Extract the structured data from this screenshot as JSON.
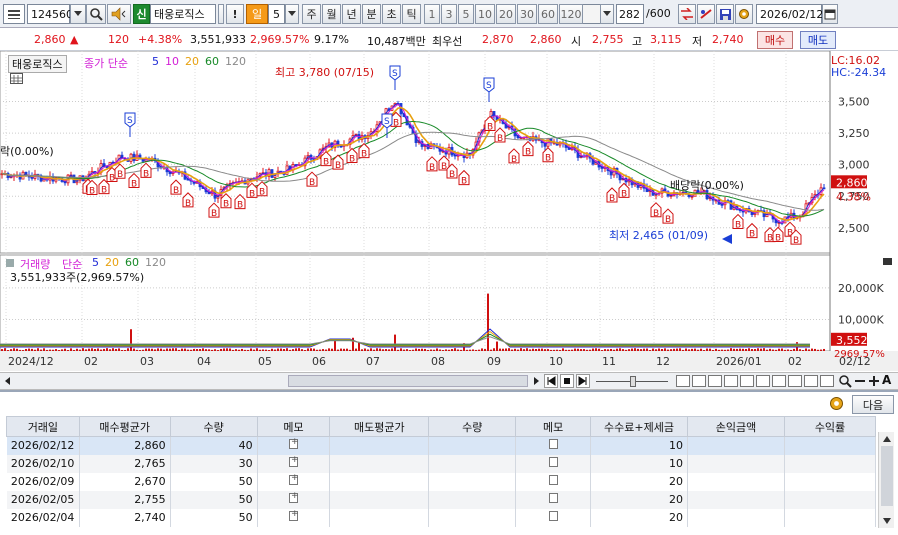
{
  "toolbar": {
    "code": "124560",
    "badge": "신",
    "name": "태웅로직스",
    "excl": "!",
    "period_day": "일",
    "period_num": "5",
    "periods": [
      "주",
      "월",
      "년",
      "분",
      "초",
      "틱"
    ],
    "nums": [
      "1",
      "3",
      "5",
      "10",
      "20",
      "30",
      "60",
      "120"
    ],
    "count": "282",
    "count_total": "/600",
    "date": "2026/02/12"
  },
  "pricebar": {
    "price": "2,860",
    "arrow": "▲",
    "change": "120",
    "change_pct": "+4.38%",
    "volume": "3,551,933",
    "vol_pct": "2,969.57%",
    "turnover": "9.17%",
    "amount": "10,487백만",
    "broker_label": "최우선",
    "ask": "2,870",
    "bid": "2,860",
    "open_label": "시",
    "open": "2,755",
    "high_label": "고",
    "high": "3,115",
    "low_label": "저",
    "low": "2,740",
    "buy": "매수",
    "sell": "매도"
  },
  "chart": {
    "legend_stock": "태웅로직스",
    "legend_ma_type": "종가 단순",
    "ma_periods": [
      "5",
      "10",
      "20",
      "60",
      "120"
    ],
    "ma_colors": [
      "#1f2bd6",
      "#d21ed6",
      "#e8a10f",
      "#188a28",
      "#8a8a8a"
    ],
    "lc": "LC:16.02",
    "hc": "HC:-24.34",
    "left_note": "락(0.00%)",
    "high_note": "최고 3,780 (07/15)",
    "low_note": "최저 2,465 (01/09)",
    "dividend_note": "배당락(0.00%)",
    "price_ticks": [
      "3,500",
      "3,250",
      "3,000",
      "2,750",
      "2,500"
    ],
    "price_tag": "2,860",
    "pct_tag": "4.38%",
    "vol_legend_label": "거래량",
    "vol_ma_type": "단순",
    "vol_ma_periods": [
      "5",
      "20",
      "60",
      "120"
    ],
    "vol_ma_colors": [
      "#1f2bd6",
      "#e8a10f",
      "#188a28",
      "#8a8a8a"
    ],
    "vol_value": "3,551,933주(2,969.57%)",
    "vol_ticks": [
      "20,000K",
      "10,000K"
    ],
    "vol_tag": "3,552K",
    "vol_pct_tag": "2969.57%",
    "x_labels": [
      "2024/12",
      "02",
      "03",
      "04",
      "05",
      "06",
      "07",
      "08",
      "09",
      "10",
      "11",
      "12",
      "2026/01",
      "02",
      "02/12"
    ],
    "marker_b": "B",
    "marker_s": "S"
  },
  "table": {
    "next": "다음",
    "headers": [
      "거래일",
      "매수평균가",
      "수량",
      "메모",
      "매도평균가",
      "수량",
      "메모",
      "수수료+제세금",
      "손익금액",
      "수익률"
    ],
    "rows": [
      {
        "date": "2026/02/12",
        "buy_avg": "2,860",
        "qty": "40",
        "fee": "10"
      },
      {
        "date": "2026/02/10",
        "buy_avg": "2,765",
        "qty": "30",
        "fee": "10"
      },
      {
        "date": "2026/02/09",
        "buy_avg": "2,670",
        "qty": "50",
        "fee": "20"
      },
      {
        "date": "2026/02/05",
        "buy_avg": "2,755",
        "qty": "50",
        "fee": "20"
      },
      {
        "date": "2026/02/04",
        "buy_avg": "2,740",
        "qty": "50",
        "fee": "20"
      }
    ]
  },
  "colors": {
    "up": "#e0141c",
    "down": "#1a3ed6",
    "accent": "#e04040",
    "blue": "#1740c8"
  }
}
